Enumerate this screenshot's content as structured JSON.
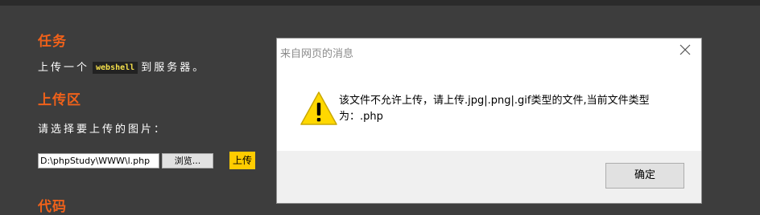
{
  "page": {
    "task_heading": "任务",
    "task_text_before": "上传一个",
    "task_code": "webshell",
    "task_text_after": "到服务器。",
    "upload_heading": "上传区",
    "upload_prompt": "请选择要上传的图片：",
    "file_path_value": "D:\\phpStudy\\WWW\\l.php",
    "browse_label": "浏览...",
    "upload_label": "上传",
    "code_heading": "代码"
  },
  "dialog": {
    "title": "来自网页的消息",
    "message": "该文件不允许上传，请上传.jpg|.png|.gif类型的文件,当前文件类型为：.php",
    "ok_label": "确定",
    "icon": "warning-icon"
  },
  "colors": {
    "background": "#3d3d3d",
    "heading": "#f0611a",
    "code_text": "#f5e04c",
    "upload_button": "#ffcc00",
    "warning_yellow": "#ffd800"
  }
}
